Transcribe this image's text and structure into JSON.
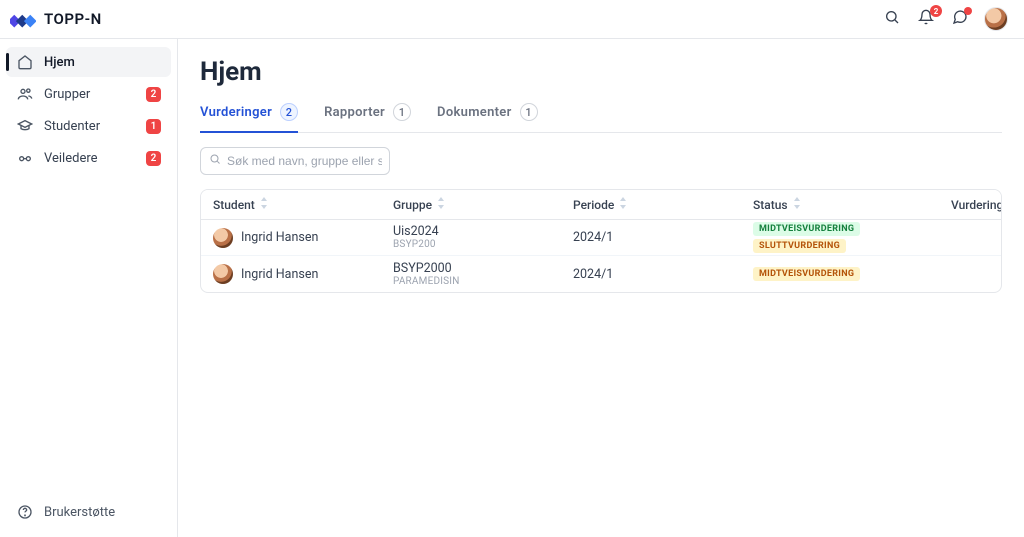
{
  "brand": {
    "name": "TOPP-N"
  },
  "header": {
    "bell_badge": "2",
    "chat_dot": true
  },
  "sidebar": {
    "items": [
      {
        "label": "Hjem",
        "icon": "home",
        "active": true,
        "badge": null
      },
      {
        "label": "Grupper",
        "icon": "users",
        "active": false,
        "badge": "2"
      },
      {
        "label": "Studenter",
        "icon": "grad-cap",
        "active": false,
        "badge": "1"
      },
      {
        "label": "Veiledere",
        "icon": "glasses",
        "active": false,
        "badge": "2"
      }
    ],
    "footer_label": "Brukerstøtte"
  },
  "page": {
    "title": "Hjem",
    "tabs": [
      {
        "label": "Vurderinger",
        "count": "2",
        "active": true
      },
      {
        "label": "Rapporter",
        "count": "1",
        "active": false
      },
      {
        "label": "Dokumenter",
        "count": "1",
        "active": false
      }
    ],
    "search_placeholder": "Søk med navn, gruppe eller sta"
  },
  "table": {
    "columns": {
      "student": "Student",
      "gruppe": "Gruppe",
      "periode": "Periode",
      "status": "Status",
      "vurderingslogg": "Vurderingslogg"
    },
    "rows": [
      {
        "student": "Ingrid Hansen",
        "gruppe": "Uis2024",
        "gruppe_sub": "BSYP200",
        "periode": "2024/1",
        "status": [
          {
            "text": "MIDTVEISVURDERING",
            "variant": "green"
          },
          {
            "text": "SLUTTVURDERING",
            "variant": "amber"
          }
        ]
      },
      {
        "student": "Ingrid Hansen",
        "gruppe": "BSYP2000",
        "gruppe_sub": "PARAMEDISIN",
        "periode": "2024/1",
        "status": [
          {
            "text": "MIDTVEISVURDERING",
            "variant": "amber"
          }
        ]
      }
    ]
  }
}
